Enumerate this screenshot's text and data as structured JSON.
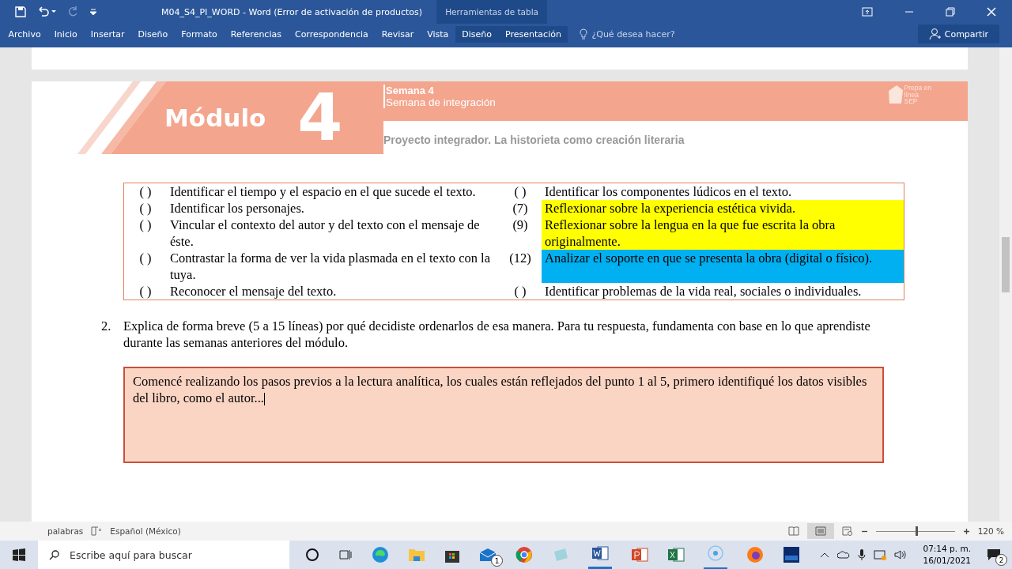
{
  "window": {
    "title": "M04_S4_PI_WORD - Word (Error de activación de productos)",
    "context_tab_group": "Herramientas de tabla",
    "tell_me": "¿Qué desea hacer?",
    "share": "Compartir"
  },
  "ribbon_tabs": [
    {
      "label": "Archivo",
      "selected": false
    },
    {
      "label": "Inicio",
      "selected": false
    },
    {
      "label": "Insertar",
      "selected": false
    },
    {
      "label": "Diseño",
      "selected": false
    },
    {
      "label": "Formato",
      "selected": false
    },
    {
      "label": "Referencias",
      "selected": false
    },
    {
      "label": "Correspondencia",
      "selected": false
    },
    {
      "label": "Revisar",
      "selected": false
    },
    {
      "label": "Vista",
      "selected": false
    },
    {
      "label": "Diseño",
      "selected": false,
      "kind": "context"
    },
    {
      "label": "Presentación",
      "selected": false,
      "kind": "context"
    }
  ],
  "header": {
    "module_word": "Módulo",
    "module_number": "4",
    "week": "Semana 4",
    "week_subtitle": "Semana de integración",
    "project": "Proyecto integrador. La historieta como creación literaria",
    "logo": [
      "Prepa en",
      "línea",
      "SEP"
    ]
  },
  "table": {
    "rows": [
      {
        "left_mark": "( )",
        "left_text": "Identificar el tiempo y el espacio en el que sucede el texto.",
        "right_mark": "( )",
        "right_text": "Identificar los componentes lúdicos en el texto."
      },
      {
        "left_mark": "( )",
        "left_text": "Identificar los personajes.",
        "right_mark": "(7)",
        "right_text": "Reflexionar sobre la experiencia estética vivida.",
        "color": "#ffff00"
      },
      {
        "left_mark": "( )",
        "left_text": "Vincular el contexto del autor y del texto con el mensaje de éste.",
        "right_mark": "(9)",
        "right_text": "Reflexionar sobre la lengua en la que fue escrita la obra originalmente.",
        "color": "#ffff00"
      },
      {
        "left_mark": "( )",
        "left_text": "Contrastar la forma de ver la vida plasmada en el texto con la tuya.",
        "right_mark": "(12)",
        "right_text": "Analizar el soporte en que se presenta la obra (digital o físico).",
        "color": "#00b0f0"
      },
      {
        "left_mark": "( )",
        "left_text": "Reconocer el mensaje del texto.",
        "right_mark": "( )",
        "right_text": "Identificar problemas de la vida real, sociales o individuales."
      }
    ]
  },
  "question": {
    "number": "2.",
    "text": "Explica de forma breve (5 a 15 líneas) por qué decidiste ordenarlos de esa manera. Para tu respuesta, fundamenta con base en lo que aprendiste durante las semanas anteriores del módulo."
  },
  "answer": {
    "value": "Comencé realizando los pasos previos a la lectura analítica, los cuales están reflejados del punto 1 al 5, primero identifiqué los datos visibles del libro, como el autor..."
  },
  "status_bar": {
    "words": "palabras",
    "language": "Español (México)",
    "zoom": "120 %",
    "zoom_slider": {
      "level": 0.5
    }
  },
  "taskbar": {
    "search_placeholder": "Escribe aquí para buscar",
    "mail_badge": "1",
    "time": "07:14 p. m.",
    "date": "16/01/2021",
    "notification_badge": "2"
  }
}
